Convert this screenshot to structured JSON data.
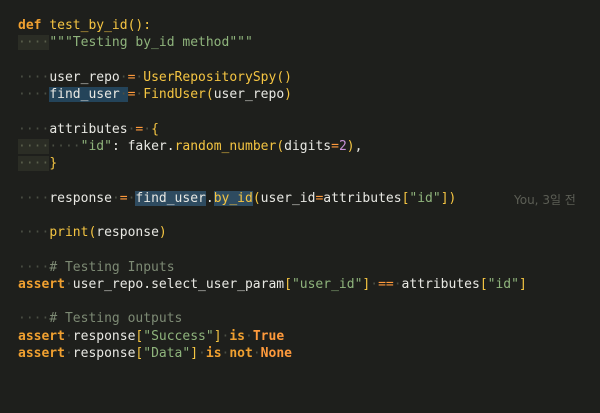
{
  "editor": {
    "language": "python",
    "blame_annotation": "You, 3일 전",
    "lines": [
      {
        "id": "def",
        "text": "def test_by_id():"
      },
      {
        "id": "docstring",
        "text": "\"\"\"Testing by_id method\"\"\""
      },
      {
        "id": "blank1",
        "text": ""
      },
      {
        "id": "user_repo",
        "text": "user_repo = UserRepositorySpy()"
      },
      {
        "id": "find_user",
        "text": "find_user = FindUser(user_repo)"
      },
      {
        "id": "blank2",
        "text": ""
      },
      {
        "id": "attributes_open",
        "text": "attributes = {"
      },
      {
        "id": "attributes_id",
        "text": "\"id\": faker.random_number(digits=2),"
      },
      {
        "id": "attributes_close",
        "text": "}"
      },
      {
        "id": "blank3",
        "text": ""
      },
      {
        "id": "response",
        "text": "response = find_user.by_id(user_id=attributes[\"id\"])"
      },
      {
        "id": "blank4",
        "text": ""
      },
      {
        "id": "print",
        "text": "print(response)"
      },
      {
        "id": "blank5",
        "text": ""
      },
      {
        "id": "comment_inputs",
        "text": "# Testing Inputs"
      },
      {
        "id": "assert_inputs",
        "text": "assert user_repo.select_user_param[\"user_id\"] == attributes[\"id\"]"
      },
      {
        "id": "blank6",
        "text": ""
      },
      {
        "id": "comment_outputs",
        "text": "# Testing outputs"
      },
      {
        "id": "assert_success",
        "text": "assert response[\"Success\"] is True"
      },
      {
        "id": "assert_data",
        "text": "assert response[\"Data\"] is not None"
      }
    ]
  },
  "colors": {
    "background": "#1e1f1c",
    "keyword": "#f0a030",
    "function": "#f5c542",
    "string": "#8fb47c",
    "number": "#c891d8",
    "comment": "#7d8a74",
    "selection": "#24445a"
  }
}
